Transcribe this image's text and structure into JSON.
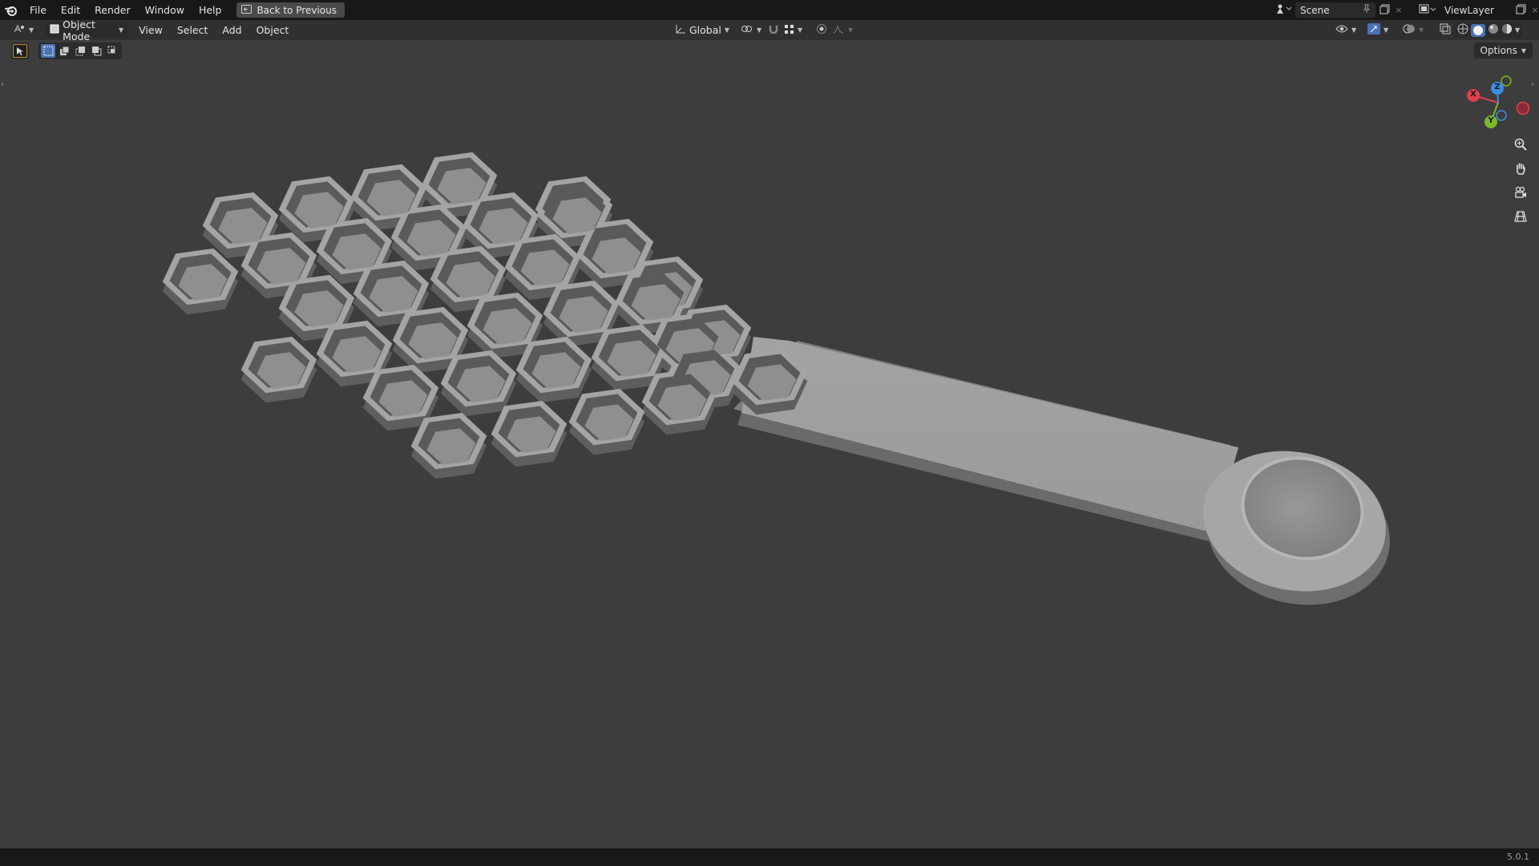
{
  "topbar": {
    "menus": [
      "File",
      "Edit",
      "Render",
      "Window",
      "Help"
    ],
    "back_label": "Back to Previous",
    "scene_name": "Scene",
    "view_layer": "ViewLayer"
  },
  "header": {
    "mode": "Object Mode",
    "menus": [
      "View",
      "Select",
      "Add",
      "Object"
    ],
    "transform_orientation": "Global"
  },
  "viewport": {
    "options_label": "Options",
    "gizmo": {
      "x": "X",
      "y": "Y",
      "z": "Z"
    },
    "colors": {
      "x_axis": "#e0404e",
      "y_axis": "#7ab72a",
      "z_axis": "#3b8ee6",
      "background": "#3d3d3d",
      "active_blue": "#4772b3"
    },
    "icons": [
      "zoom-icon",
      "pan-hand-icon",
      "camera-icon",
      "grid-icon"
    ]
  },
  "status": {
    "version": "5.0.1"
  }
}
